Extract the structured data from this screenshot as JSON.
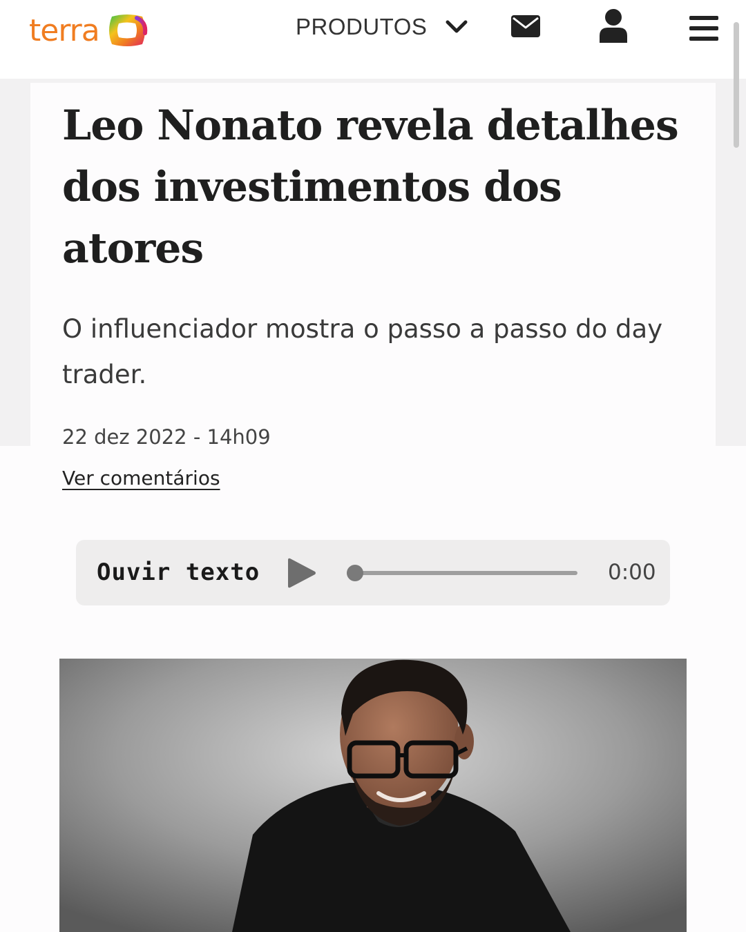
{
  "header": {
    "logo_text": "terra",
    "products_label": "PRODUTOS",
    "icons": [
      "chevron-down-icon",
      "mail-icon",
      "user-icon",
      "menu-icon"
    ],
    "brand_color": "#f07d21"
  },
  "article": {
    "title": "Leo Nonato revela detalhes dos investimentos dos atores",
    "subtitle": "O influenciador mostra o passo a passo do day trader.",
    "date": "22 dez 2022 - 14h09",
    "comments_link": "Ver comentários"
  },
  "audio_player": {
    "label": "Ouvir texto",
    "time": "0:00",
    "progress": 0
  },
  "image": {
    "subject": "man-with-glasses-portrait"
  }
}
